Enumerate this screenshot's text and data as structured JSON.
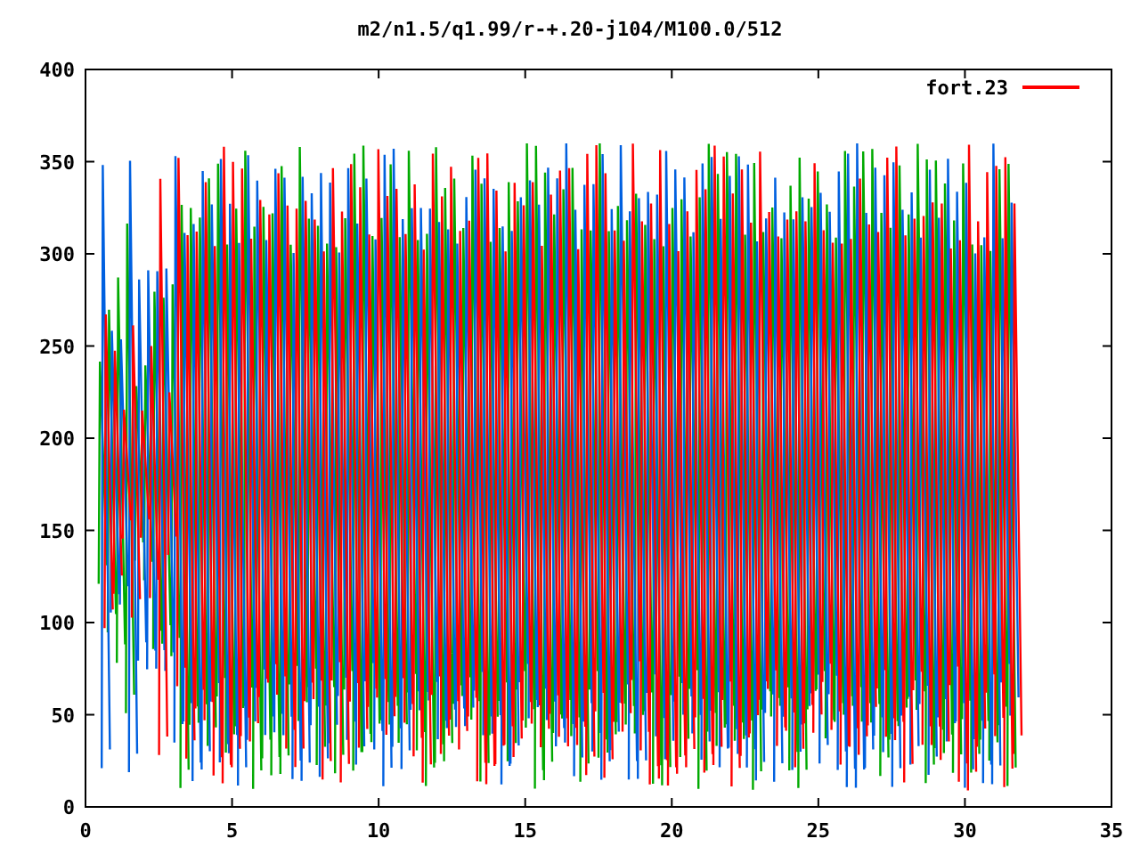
{
  "title": "m2/n1.5/q1.99/r-+.20-j104/M100.0/512",
  "legend": {
    "label": "fort.23",
    "color": "#ff0000"
  },
  "x_axis": {
    "ticks": [
      "0",
      "5",
      "10",
      "15",
      "20",
      "25",
      "30",
      "35"
    ]
  },
  "y_axis": {
    "ticks": [
      "400",
      "350",
      "300",
      "250",
      "200",
      "150",
      "100",
      "50",
      "0"
    ]
  }
}
